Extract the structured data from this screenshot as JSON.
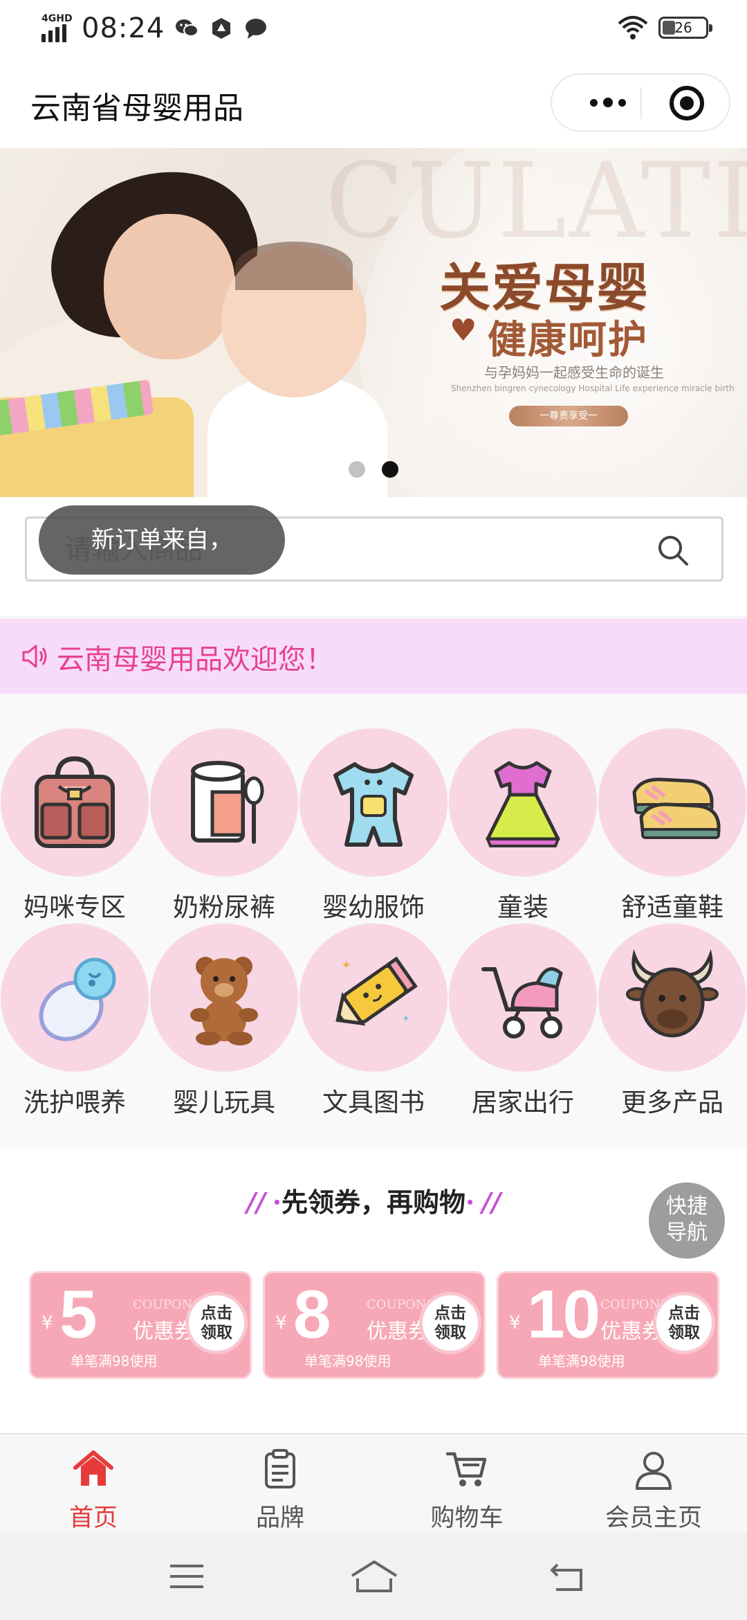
{
  "status_bar": {
    "network": "4GHD",
    "time": "08:24",
    "battery": "26"
  },
  "nav_bar": {
    "title": "云南省母婴用品"
  },
  "banner": {
    "bg_word": "CULATION",
    "headline": "关爱母婴",
    "subheadline": "健康呵护",
    "tagline": "与孕妈妈一起感受生命的诞生",
    "tagline_en": "Shenzhen bingren cynecology Hospital Life experience miracle birth",
    "pill_text": "一尊贵享受一",
    "slide_count": 2,
    "active_slide": 2
  },
  "search": {
    "placeholder": "请输入商品"
  },
  "toast": {
    "text": "新订单来自，"
  },
  "notice": {
    "text": "云南母婴用品欢迎您！"
  },
  "categories": [
    {
      "label": "妈咪专区",
      "icon": "handbag-icon"
    },
    {
      "label": "奶粉尿裤",
      "icon": "milk-powder-icon"
    },
    {
      "label": "婴幼服饰",
      "icon": "baby-romper-icon"
    },
    {
      "label": "童装",
      "icon": "dress-icon"
    },
    {
      "label": "舒适童鞋",
      "icon": "shoes-icon"
    },
    {
      "label": "洗护喂养",
      "icon": "pacifier-icon"
    },
    {
      "label": "婴儿玩具",
      "icon": "teddy-bear-icon"
    },
    {
      "label": "文具图书",
      "icon": "pencil-icon"
    },
    {
      "label": "居家出行",
      "icon": "stroller-icon"
    },
    {
      "label": "更多产品",
      "icon": "bull-icon"
    }
  ],
  "coupons_section": {
    "title": "先领券，再购物",
    "items": [
      {
        "currency": "¥",
        "amount": "5",
        "en": "COUPONS",
        "name": "优惠券",
        "condition": "单笔满98使用",
        "button": "点击\n领取"
      },
      {
        "currency": "¥",
        "amount": "8",
        "en": "COUPONS",
        "name": "优惠券",
        "condition": "单笔满98使用",
        "button": "点击\n领取"
      },
      {
        "currency": "¥",
        "amount": "10",
        "en": "COUPONS",
        "name": "优惠券",
        "condition": "单笔满98使用",
        "button": "点击\n领取"
      }
    ]
  },
  "quick_nav": {
    "label": "快捷\n导航"
  },
  "tab_bar": {
    "items": [
      {
        "label": "首页",
        "icon": "home-icon",
        "active": true
      },
      {
        "label": "品牌",
        "icon": "clipboard-icon",
        "active": false
      },
      {
        "label": "购物车",
        "icon": "cart-icon",
        "active": false
      },
      {
        "label": "会员主页",
        "icon": "user-icon",
        "active": false
      }
    ]
  },
  "colors": {
    "accent": "#e63b3b",
    "notice_text": "#e7418f",
    "notice_bg": "#f7dcfa",
    "coupon": "#f7a8b6",
    "category_circle": "#f8d6e3"
  }
}
